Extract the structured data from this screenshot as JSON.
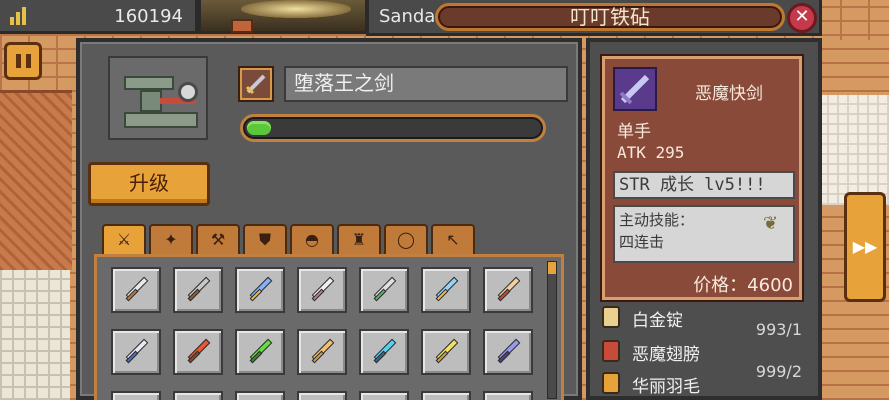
{
  "hud": {
    "money": "160194",
    "player_name": "Sanda",
    "shop_title": "叮叮铁砧",
    "close_symbol": "✕"
  },
  "forge": {
    "upgrade_label": "升级",
    "item_name": "堕落王之剑",
    "progress_percent": 8
  },
  "category_tabs": [
    {
      "icon": "sword-icon",
      "glyph": "⚔"
    },
    {
      "icon": "staff-icon",
      "glyph": "✦"
    },
    {
      "icon": "axe-icon",
      "glyph": "⚒"
    },
    {
      "icon": "shield-icon",
      "glyph": "⛊"
    },
    {
      "icon": "helmet-icon",
      "glyph": "◓"
    },
    {
      "icon": "armor-icon",
      "glyph": "♜"
    },
    {
      "icon": "ring-icon",
      "glyph": "◯"
    },
    {
      "icon": "bow-icon",
      "glyph": "↖"
    }
  ],
  "inventory": [
    {
      "blade": "#e8e8e8",
      "hilt": "#c07a3a"
    },
    {
      "blade": "#c8c8c8",
      "hilt": "#9a5a2a"
    },
    {
      "blade": "#8ab0f0",
      "hilt": "#e8c048"
    },
    {
      "blade": "#f0f0f0",
      "hilt": "#b87a9a"
    },
    {
      "blade": "#e0e0e0",
      "hilt": "#5ab86a"
    },
    {
      "blade": "#9ad0f0",
      "hilt": "#e8c048"
    },
    {
      "blade": "#f0d0a0",
      "hilt": "#c84a3a"
    },
    {
      "blade": "#e8e8f0",
      "hilt": "#4a6ac8"
    },
    {
      "blade": "#e05a3a",
      "hilt": "#8a4a2a"
    },
    {
      "blade": "#6ad84a",
      "hilt": "#3a8a2a"
    },
    {
      "blade": "#f0c07a",
      "hilt": "#c8a048"
    },
    {
      "blade": "#5ad0f0",
      "hilt": "#3a6a8a"
    },
    {
      "blade": "#f0e070",
      "hilt": "#c8a048"
    },
    {
      "blade": "#9a9ae8",
      "hilt": "#5a3a8a"
    }
  ],
  "info": {
    "item_title": "恶魔快剑",
    "hand_type": "单手",
    "atk": "ATK 295",
    "growth": "STR 成长 lv5!!!",
    "skill_label": "主动技能：",
    "skill_name": "四连击",
    "price": "价格：4600"
  },
  "materials": [
    {
      "name": "白金锭",
      "count": "",
      "icon_color": "#e8d090"
    },
    {
      "name": "恶魔翅膀",
      "count": "993/1",
      "icon_color": "#c84a3a"
    },
    {
      "name": "华丽羽毛",
      "count": "999/2",
      "icon_color": "#e8a23a"
    }
  ],
  "colors": {
    "accent": "#e8a23a",
    "panel": "#5a5a5a",
    "progress": "#5ac83a",
    "card": "#8a4a3a"
  }
}
